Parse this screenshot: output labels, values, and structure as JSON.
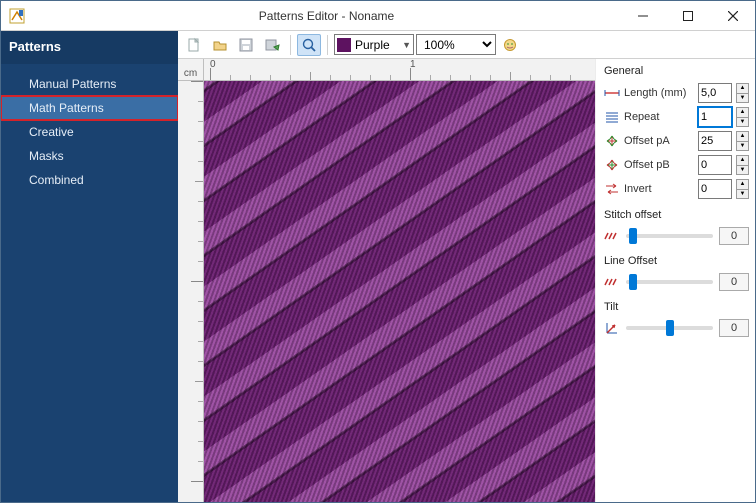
{
  "window": {
    "title": "Patterns Editor - Noname"
  },
  "sidebar": {
    "title": "Patterns",
    "items": [
      {
        "label": "Manual Patterns"
      },
      {
        "label": "Math Patterns"
      },
      {
        "label": "Creative"
      },
      {
        "label": "Masks"
      },
      {
        "label": "Combined"
      }
    ],
    "selected_index": 1,
    "highlighted_index": 1
  },
  "toolbar": {
    "color_name": "Purple",
    "color_hex": "#5d1260",
    "zoom": "100%"
  },
  "ruler": {
    "unit": "cm",
    "major0": "0",
    "major1": "1"
  },
  "props": {
    "general": {
      "title": "General",
      "rows": {
        "length": {
          "label": "Length (mm)",
          "value": "5,0"
        },
        "repeat": {
          "label": "Repeat",
          "value": "1"
        },
        "offset_pa": {
          "label": "Offset pA",
          "value": "25"
        },
        "offset_pb": {
          "label": "Offset pB",
          "value": "0"
        },
        "invert": {
          "label": "Invert",
          "value": "0"
        }
      }
    },
    "stitch_offset": {
      "title": "Stitch offset",
      "value": "0",
      "pos_pct": 8
    },
    "line_offset": {
      "title": "Line Offset",
      "value": "0",
      "pos_pct": 8
    },
    "tilt": {
      "title": "Tilt",
      "value": "0",
      "pos_pct": 50
    }
  }
}
